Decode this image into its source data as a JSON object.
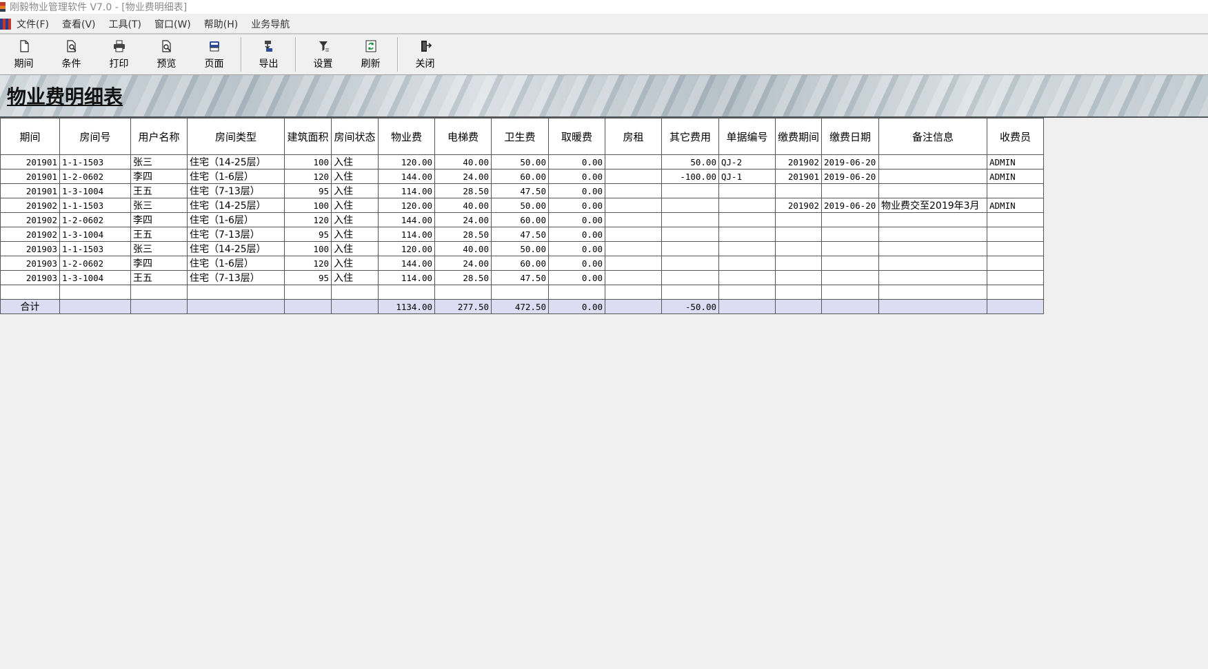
{
  "window": {
    "title": "刚毅物业管理软件 V7.0 - [物业费明细表]"
  },
  "menu": [
    "文件(F)",
    "查看(V)",
    "工具(T)",
    "窗口(W)",
    "帮助(H)",
    "业务导航"
  ],
  "toolbar": {
    "period": "期间",
    "condition": "条件",
    "print": "打印",
    "preview": "预览",
    "page": "页面",
    "export": "导出",
    "settings": "设置",
    "refresh": "刷新",
    "close": "关闭"
  },
  "report_title": "物业费明细表",
  "table": {
    "columns": [
      "期间",
      "房间号",
      "用户名称",
      "房间类型",
      "建筑面积",
      "房间状态",
      "物业费",
      "电梯费",
      "卫生费",
      "取暖费",
      "房租",
      "其它费用",
      "单据编号",
      "缴费期间",
      "缴费日期",
      "备注信息",
      "收费员"
    ],
    "rows": [
      [
        "201901",
        "1-1-1503",
        "张三",
        "住宅（14-25层）",
        "100",
        "入住",
        "120.00",
        "40.00",
        "50.00",
        "0.00",
        "",
        "50.00",
        "QJ-2",
        "201902",
        "2019-06-20",
        "",
        "ADMIN"
      ],
      [
        "201901",
        "1-2-0602",
        "李四",
        "住宅（1-6层）",
        "120",
        "入住",
        "144.00",
        "24.00",
        "60.00",
        "0.00",
        "",
        "-100.00",
        "QJ-1",
        "201901",
        "2019-06-20",
        "",
        "ADMIN"
      ],
      [
        "201901",
        "1-3-1004",
        "王五",
        "住宅（7-13层）",
        "95",
        "入住",
        "114.00",
        "28.50",
        "47.50",
        "0.00",
        "",
        "",
        "",
        "",
        "",
        "",
        ""
      ],
      [
        "201902",
        "1-1-1503",
        "张三",
        "住宅（14-25层）",
        "100",
        "入住",
        "120.00",
        "40.00",
        "50.00",
        "0.00",
        "",
        "",
        "",
        "201902",
        "2019-06-20",
        "物业费交至2019年3月",
        "ADMIN"
      ],
      [
        "201902",
        "1-2-0602",
        "李四",
        "住宅（1-6层）",
        "120",
        "入住",
        "144.00",
        "24.00",
        "60.00",
        "0.00",
        "",
        "",
        "",
        "",
        "",
        "",
        ""
      ],
      [
        "201902",
        "1-3-1004",
        "王五",
        "住宅（7-13层）",
        "95",
        "入住",
        "114.00",
        "28.50",
        "47.50",
        "0.00",
        "",
        "",
        "",
        "",
        "",
        "",
        ""
      ],
      [
        "201903",
        "1-1-1503",
        "张三",
        "住宅（14-25层）",
        "100",
        "入住",
        "120.00",
        "40.00",
        "50.00",
        "0.00",
        "",
        "",
        "",
        "",
        "",
        "",
        ""
      ],
      [
        "201903",
        "1-2-0602",
        "李四",
        "住宅（1-6层）",
        "120",
        "入住",
        "144.00",
        "24.00",
        "60.00",
        "0.00",
        "",
        "",
        "",
        "",
        "",
        "",
        ""
      ],
      [
        "201903",
        "1-3-1004",
        "王五",
        "住宅（7-13层）",
        "95",
        "入住",
        "114.00",
        "28.50",
        "47.50",
        "0.00",
        "",
        "",
        "",
        "",
        "",
        "",
        ""
      ],
      [
        "",
        "",
        "",
        "",
        "",
        "",
        "",
        "",
        "",
        "",
        "",
        "",
        "",
        "",
        "",
        "",
        ""
      ]
    ],
    "total": [
      "合计",
      "",
      "",
      "",
      "",
      "",
      "1134.00",
      "277.50",
      "472.50",
      "0.00",
      "",
      "-50.00",
      "",
      "",
      "",
      "",
      ""
    ]
  },
  "colors": {
    "total_row_bg": "#dcdcf2",
    "grid_line": "#555555"
  }
}
